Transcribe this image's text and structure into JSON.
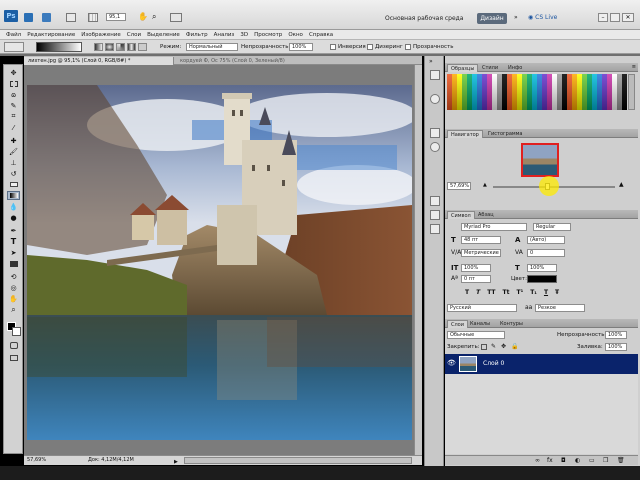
{
  "app": {
    "logo": "Ps",
    "workspace_label": "Основная рабочая среда",
    "design_button": "Дизайн",
    "cs_live": "CS Live",
    "zoom_field": "95,1"
  },
  "menu": [
    "Файл",
    "Редактирование",
    "Изображение",
    "Слои",
    "Выделение",
    "Фильтр",
    "Анализ",
    "3D",
    "Просмотр",
    "Окно",
    "Справка"
  ],
  "options": {
    "mode_label": "Режим:",
    "mode_value": "Нормальный",
    "opacity_label": "Непрозрачность:",
    "opacity_value": "100%",
    "inversion_label": "Инверсия",
    "dither_label": "Дизеринг",
    "transparency_label": "Прозрачность"
  },
  "documents": {
    "tab_active": "лихтен.jpg @ 95,1% (Слой 0, RGB/8#) *",
    "tab_inactive": "кордуей Ф, Ос 75% (Слой 0, Зеленый/8)"
  },
  "status": {
    "zoom": "57,69%",
    "doc": "Док: 4,12M/4,12M"
  },
  "swatches": {
    "tabs": [
      "Образцы",
      "Стили",
      "Инфо"
    ],
    "colors": [
      "#ff0000",
      "#ffff00",
      "#00ff00",
      "#00ffff",
      "#0000ff",
      "#ff00ff",
      "#ffffff",
      "#000000",
      "#c00000",
      "#ff8000",
      "#80ff00",
      "#00c0c0",
      "#0060ff",
      "#8000ff",
      "#ff80c0",
      "#808080",
      "#800000",
      "#808000",
      "#008000",
      "#008080",
      "#000080",
      "#800080",
      "#c0c0c0",
      "#404040"
    ]
  },
  "navigator": {
    "tabs": [
      "Навигатор",
      "Гистограмма"
    ],
    "zoom": "57,69%"
  },
  "character": {
    "tabs": [
      "Символ",
      "Абзац"
    ],
    "font_family": "Myriad Pro",
    "font_style": "Regular",
    "size": "48 пт",
    "leading": "(Авто)",
    "kerning": "Метрические",
    "tracking": "0",
    "vscale": "100%",
    "hscale": "100%",
    "baseline": "0 пт",
    "color_label": "Цвет:",
    "language": "Русский",
    "aa": "Резкое",
    "glyph_buttons": [
      "T",
      "T",
      "TT",
      "Tt",
      "T¹",
      "T₁",
      "T",
      "Ŧ"
    ]
  },
  "layers": {
    "tabs": [
      "Слои",
      "Каналы",
      "Контуры"
    ],
    "blend": "Обычные",
    "opacity_label": "Непрозрачность:",
    "opacity": "100%",
    "lock_label": "Закрепить:",
    "fill_label": "Заливка:",
    "fill": "100%",
    "layer_name": "Слой 0"
  }
}
